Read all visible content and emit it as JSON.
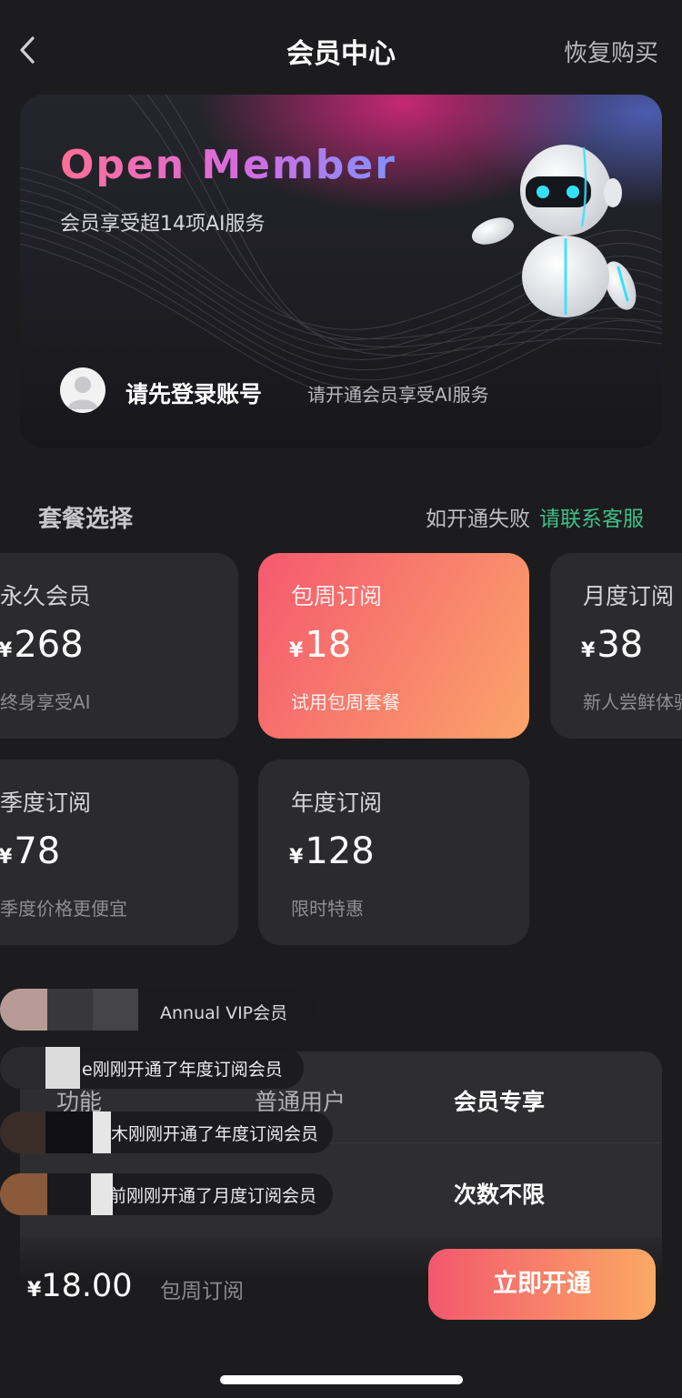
{
  "header": {
    "title": "会员中心",
    "restore_label": "恢复购买"
  },
  "hero": {
    "title": "Open Member",
    "subtitle": "会员享受超14项AI服务",
    "login_label": "请先登录账号",
    "login_hint": "请开通会员享受AI服务"
  },
  "packages": {
    "section_title": "套餐选择",
    "fail_text": "如开通失败",
    "contact_link": "请联系客服",
    "currency": "¥",
    "plans": [
      {
        "name": "永久会员",
        "price": "268",
        "desc": "终身享受AI"
      },
      {
        "name": "包周订阅",
        "price": "18",
        "desc": "试用包周套餐",
        "selected": true
      },
      {
        "name": "月度订阅",
        "price": "38",
        "desc": "新人尝鲜体验"
      },
      {
        "name": "季度订阅",
        "price": "78",
        "desc": "季度价格更便宜"
      },
      {
        "name": "年度订阅",
        "price": "128",
        "desc": "限时特惠"
      }
    ]
  },
  "toasts": [
    {
      "text": "Annual VIP会员"
    },
    {
      "text": "e刚刚开通了年度订阅会员"
    },
    {
      "text": "木刚刚开通了年度订阅会员"
    },
    {
      "text": "前刚刚开通了月度订阅会员"
    }
  ],
  "comparison": {
    "headers": [
      "功能",
      "普通用户",
      "会员专享"
    ],
    "rows": [
      {
        "vip": "次数不限"
      }
    ]
  },
  "footer": {
    "currency": "¥",
    "total": "18.00",
    "selected_plan": "包周订阅",
    "buy_label": "立即开通"
  },
  "colors": {
    "accent_start": "#f5596f",
    "accent_end": "#fba46a",
    "contact": "#3fbf8a",
    "background": "#1c1c1e",
    "card": "#2b2b2d"
  }
}
